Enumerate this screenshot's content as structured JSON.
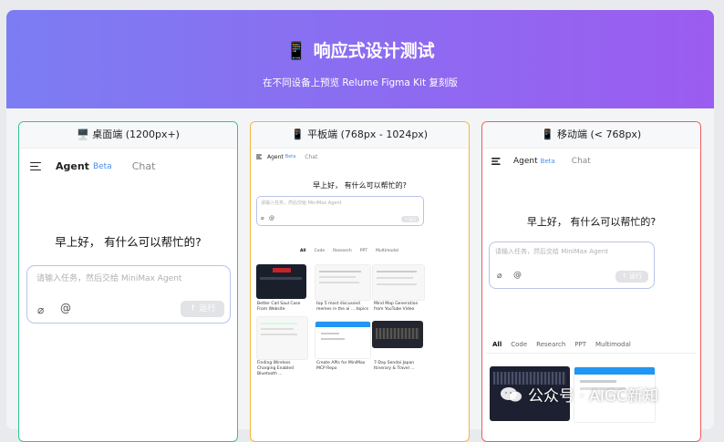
{
  "hero": {
    "title": "📱 响应式设计测试",
    "subtitle": "在不同设备上预览 Relume Figma Kit 复刻版"
  },
  "desktop": {
    "header": "🖥️ 桌面端 (1200px+)",
    "nav": {
      "agent": "Agent",
      "beta": "Beta",
      "chat": "Chat"
    },
    "greeting": "早上好， 有什么可以帮忙的?",
    "input_placeholder": "请输入任务，然后交给 MiniMax Agent",
    "run_label": "↑ 运行"
  },
  "tablet": {
    "header": "📱 平板端 (768px - 1024px)",
    "nav": {
      "agent": "Agent",
      "beta": "Beta",
      "chat": "Chat"
    },
    "greeting": "早上好， 有什么可以帮忙的?",
    "input_placeholder": "请输入任务，然后交给 MiniMax Agent",
    "run_label": "↑ 运行",
    "tabs": [
      "All",
      "Code",
      "Research",
      "PPT",
      "Multimodal"
    ],
    "cards": [
      {
        "caption": "Better Call Saul Case From Website"
      },
      {
        "caption": "top 5 most discussed memes in the ai ... topics"
      },
      {
        "caption": "Mind Map Generation from YouTube Video"
      },
      {
        "caption": "Finding Wireless Charging Enabled Bluetooth ..."
      },
      {
        "caption": "Create APIs for MiniMax MCP Repo"
      },
      {
        "caption": "7-Day Sendai Japan Itinerary & Travel ..."
      }
    ]
  },
  "mobile": {
    "header": "📱 移动端 (< 768px)",
    "nav": {
      "agent": "Agent",
      "beta": "Beta",
      "chat": "Chat"
    },
    "greeting": "早上好， 有什么可以帮忙的?",
    "input_placeholder": "请输入任务，然后交给 MiniMax Agent",
    "run_label": "↑ 运行",
    "tabs": [
      "All",
      "Code",
      "Research",
      "PPT",
      "Multimodal"
    ]
  },
  "watermark": "公众号 · AIGC新知"
}
